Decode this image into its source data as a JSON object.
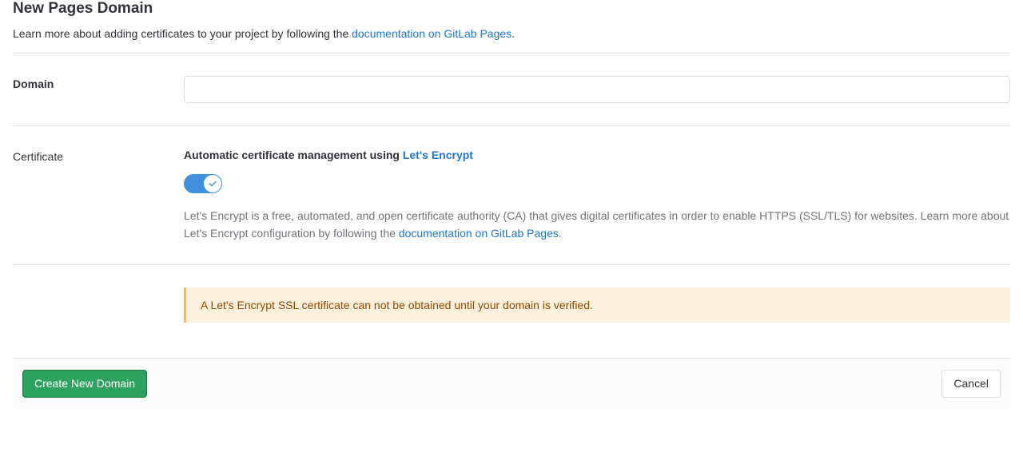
{
  "page": {
    "title": "New Pages Domain",
    "intro_prefix": "Learn more about adding certificates to your project by following the ",
    "intro_link": "documentation on GitLab Pages",
    "intro_suffix": "."
  },
  "domain_section": {
    "label": "Domain",
    "value": ""
  },
  "cert_section": {
    "label": "Certificate",
    "heading_prefix": "Automatic certificate management using ",
    "heading_link": "Let's Encrypt",
    "toggle_on": true,
    "desc_prefix": "Let's Encrypt is a free, automated, and open certificate authority (CA) that gives digital certificates in order to enable HTTPS (SSL/TLS) for websites. Learn more about Let's Encrypt configuration by following the ",
    "desc_link": "documentation on GitLab Pages",
    "desc_suffix": "."
  },
  "alert": {
    "text": "A Let's Encrypt SSL certificate can not be obtained until your domain is verified."
  },
  "footer": {
    "create_label": "Create New Domain",
    "cancel_label": "Cancel"
  }
}
